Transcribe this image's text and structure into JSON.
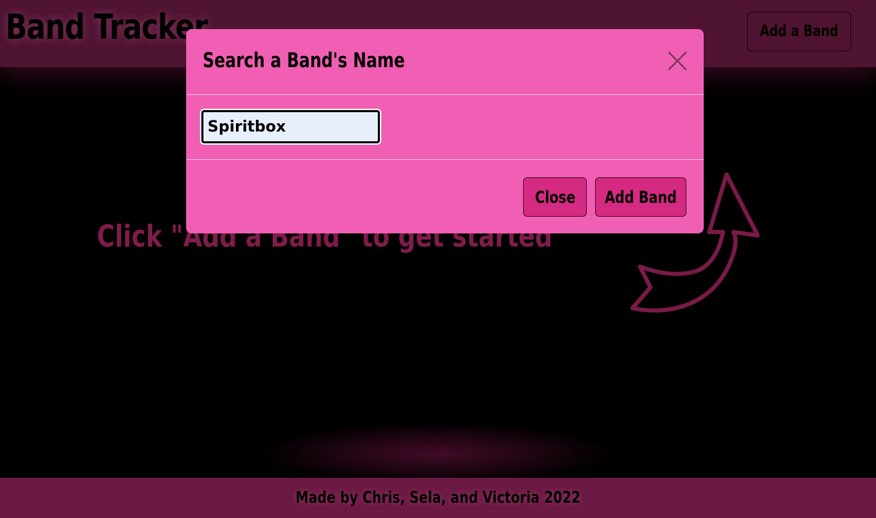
{
  "header": {
    "brand": "Band Tracker",
    "add_band_label": "Add a Band"
  },
  "main": {
    "message": "Click \"Add a Band\" to get started",
    "arrow_icon": "curved-arrow-icon"
  },
  "footer": {
    "text": "Made by Chris, Sela, and Victoria 2022"
  },
  "modal": {
    "title": "Search a Band's Name",
    "close_icon": "close-icon",
    "search_value": "Spiritbox",
    "close_label": "Close",
    "add_label": "Add Band"
  },
  "colors": {
    "header_bg": "#4f1432",
    "modal_bg": "#f05fb4",
    "button_bg": "#d42a82",
    "message_color": "#7f1c4b",
    "footer_bg": "#6b1a43"
  }
}
